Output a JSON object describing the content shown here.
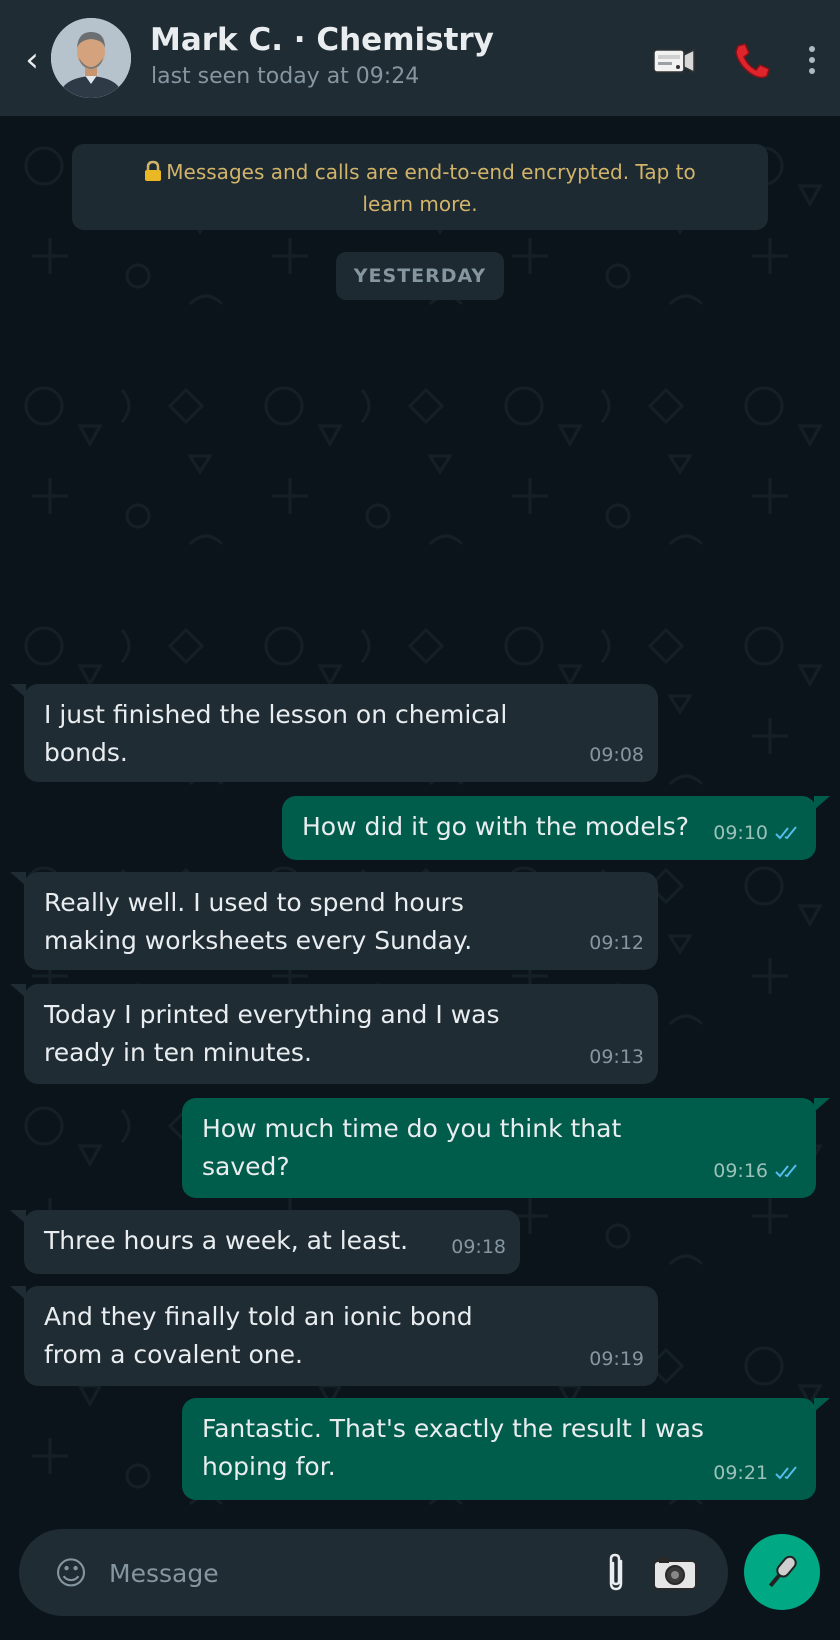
{
  "header": {
    "back_glyph": "‹",
    "contact_name": "Mark C. · Chemistry",
    "status": "last seen today at 09:24",
    "icons": [
      "back-icon",
      "video-icon",
      "phone-icon",
      "menu-icon"
    ]
  },
  "chat": {
    "encryption_notice": "Messages and calls are end-to-end encrypted. Tap to learn more.",
    "day_label": "YESTERDAY",
    "messages": [
      {
        "direction": "incoming",
        "text": "I just finished the lesson on chemical\nbonds.",
        "time": "09:08"
      },
      {
        "direction": "outgoing",
        "text": "How did it go with the models?",
        "time": "09:10",
        "read": true
      },
      {
        "direction": "incoming",
        "text": "Really well. I used to spend hours\nmaking worksheets every Sunday.",
        "time": "09:12"
      },
      {
        "direction": "incoming",
        "text": "Today I printed everything and I was\nready in ten minutes.",
        "time": "09:13"
      },
      {
        "direction": "outgoing",
        "text": "How much time do you think that\nsaved?",
        "time": "09:16",
        "read": true
      },
      {
        "direction": "incoming",
        "text": "Three hours a week, at least.",
        "time": "09:18"
      },
      {
        "direction": "incoming",
        "text": "And they finally told an ionic bond\nfrom a covalent one.",
        "time": "09:19"
      },
      {
        "direction": "outgoing",
        "text": "Fantastic. That's exactly the result I was\nhoping for.",
        "time": "09:21",
        "read": true
      }
    ]
  },
  "composer": {
    "placeholder": "Message",
    "emoji_glyph": "☺",
    "icons": [
      "emoji-icon",
      "paperclip-icon",
      "camera-icon",
      "microphone-icon"
    ]
  },
  "colors": {
    "background": "#0b141a",
    "header": "#1f2c34",
    "incoming_bubble": "#1f2c34",
    "outgoing_bubble": "#005c4b",
    "accent": "#00a884",
    "read_ticks": "#53bdeb",
    "notice_text": "#d2b36a"
  }
}
